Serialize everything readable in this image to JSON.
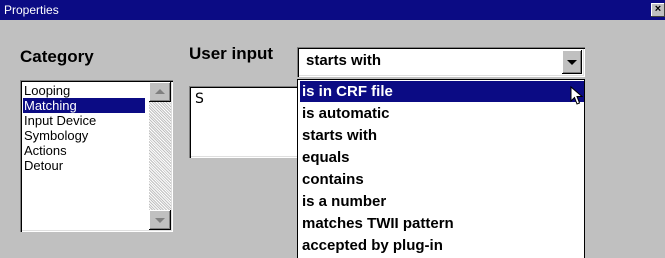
{
  "window": {
    "title": "Properties",
    "close_glyph": "×"
  },
  "category": {
    "label": "Category",
    "items": [
      {
        "label": "Looping",
        "selected": false
      },
      {
        "label": "Matching",
        "selected": true
      },
      {
        "label": "Input Device",
        "selected": false
      },
      {
        "label": "Symbology",
        "selected": false
      },
      {
        "label": "Actions",
        "selected": false
      },
      {
        "label": "Detour",
        "selected": false
      }
    ]
  },
  "user_input": {
    "label": "User input",
    "text_value": "S",
    "combo_value": "starts with",
    "options": [
      {
        "label": "is in CRF file",
        "highlighted": true
      },
      {
        "label": "is automatic",
        "highlighted": false
      },
      {
        "label": "starts with",
        "highlighted": false
      },
      {
        "label": "equals",
        "highlighted": false
      },
      {
        "label": "contains",
        "highlighted": false
      },
      {
        "label": "is a number",
        "highlighted": false
      },
      {
        "label": "matches TWII pattern",
        "highlighted": false
      },
      {
        "label": "accepted by plug-in",
        "highlighted": false
      }
    ]
  },
  "icons": {
    "close": "close-icon",
    "scroll_up": "arrow-up-icon",
    "scroll_down": "arrow-down-icon",
    "combo_toggle": "chevron-down-icon",
    "cursor": "mouse-pointer-icon"
  },
  "colors": {
    "face": "#c0c0c0",
    "titlebar": "#0b0b84",
    "selection": "#0b0b84",
    "selection_text": "#ffffff"
  }
}
